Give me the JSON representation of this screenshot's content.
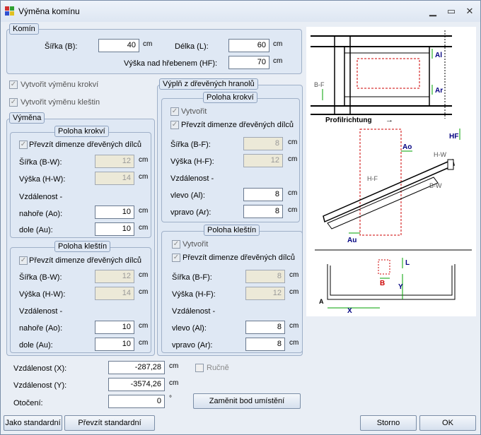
{
  "window": {
    "title": "Výměna komínu",
    "min_icon": "minimize-icon",
    "max_icon": "maximize-icon",
    "close_icon": "close-icon",
    "min_glyph": "▁",
    "max_glyph": "▭",
    "close_glyph": "✕"
  },
  "komin": {
    "title": "Komín",
    "sirka_label": "Šířka (B):",
    "sirka_value": "40",
    "sirka_unit": "cm",
    "delka_label": "Délka (L):",
    "delka_value": "60",
    "delka_unit": "cm",
    "vyska_label": "Výška nad hřebenem (HF):",
    "vyska_value": "70",
    "vyska_unit": "cm"
  },
  "checks": {
    "krokvi_label": "Vytvořit výměnu krokví",
    "klestin_label": "Vytvořit výměnu kleštin",
    "check_glyph": "✓"
  },
  "vymena": {
    "title": "Výměna",
    "krokvi": {
      "title": "Poloha krokví",
      "prevzit_label": "Převzít dimenze dřevěných dílců",
      "sirka_label": "Šířka (B-W):",
      "sirka_value": "12",
      "vyska_label": "Výška (H-W):",
      "vyska_value": "14",
      "vzdalenost_label": "Vzdálenost -",
      "nahore_label": "nahoře (Ao):",
      "nahore_value": "10",
      "dole_label": "dole (Au):",
      "dole_value": "10",
      "unit": "cm"
    },
    "klestin": {
      "title": "Poloha kleštín",
      "prevzit_label": "Převzít dimenze dřevěných dílců",
      "sirka_label": "Šířka (B-W):",
      "sirka_value": "12",
      "vyska_label": "Výška (H-W):",
      "vyska_value": "14",
      "vzdalenost_label": "Vzdálenost -",
      "nahore_label": "nahoře (Ao):",
      "nahore_value": "10",
      "dole_label": "dole (Au):",
      "dole_value": "10",
      "unit": "cm"
    }
  },
  "vypln": {
    "title": "Výplň z dřevěných hranolů",
    "krokvi": {
      "title": "Poloha krokví",
      "vytvorit_label": "Vytvořit",
      "prevzit_label": "Převzít dimenze dřevěných dílců",
      "sirka_label": "Šířka (B-F):",
      "sirka_value": "8",
      "vyska_label": "Výška (H-F):",
      "vyska_value": "12",
      "vzdalenost_label": "Vzdálenost -",
      "vlevo_label": "vlevo (Al):",
      "vlevo_value": "8",
      "vpravo_label": "vpravo (Ar):",
      "vpravo_value": "8",
      "unit": "cm"
    },
    "klestin": {
      "title": "Poloha kleštín",
      "vytvorit_label": "Vytvořit",
      "prevzit_label": "Převzít dimenze dřevěných dílců",
      "sirka_label": "Šířka (B-F):",
      "sirka_value": "8",
      "vyska_label": "Výška (H-F):",
      "vyska_value": "12",
      "vzdalenost_label": "Vzdálenost -",
      "vlevo_label": "vlevo (Al):",
      "vlevo_value": "8",
      "vpravo_label": "vpravo (Ar):",
      "vpravo_value": "8",
      "unit": "cm"
    }
  },
  "placement": {
    "x_label": "Vzdálenost (X):",
    "x_value": "-287,28",
    "x_unit": "cm",
    "y_label": "Vzdálenost (Y):",
    "y_value": "-3574,26",
    "y_unit": "cm",
    "rot_label": "Otočení:",
    "rot_value": "0",
    "rot_unit": "°",
    "rucne_label": "Ručně",
    "zamenit_label": "Zaměnit bod umístění"
  },
  "buttons": {
    "jako_label": "Jako standardní",
    "prevzit_label": "Převzít standardní",
    "storno_label": "Storno",
    "ok_label": "OK"
  },
  "diagram": {
    "al": "Al",
    "ar": "Ar",
    "bf": "B-F",
    "profil": "Profilrichtung",
    "arrow": "→",
    "hf": "HF",
    "ao": "Ao",
    "hw": "H-W",
    "hf2": "H-F",
    "bw": "B-W",
    "au": "Au",
    "l": "L",
    "b": "B",
    "y": "Y",
    "a": "A",
    "x": "X",
    "colors": {
      "red": "#cc0000",
      "green": "#00a000",
      "blue": "#000080"
    }
  }
}
